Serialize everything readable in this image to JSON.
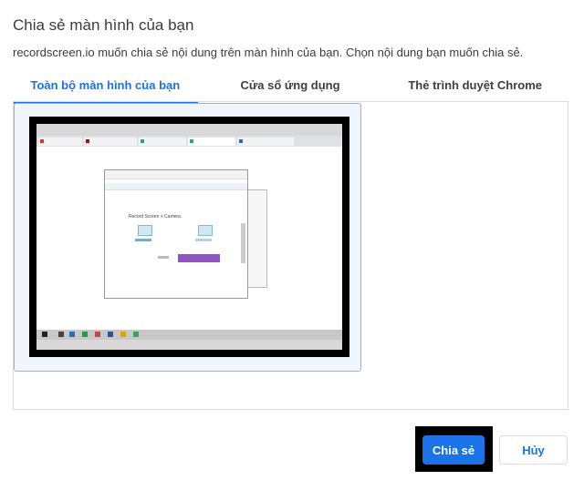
{
  "dialog": {
    "title": "Chia sẻ màn hình của bạn",
    "description": "recordscreen.io muốn chia sẻ nội dung trên màn hình của bạn. Chọn nội dung bạn muốn chia sẻ."
  },
  "tabs": [
    {
      "label": "Toàn bộ màn hình của bạn",
      "active": true
    },
    {
      "label": "Cửa sổ ứng dụng",
      "active": false
    },
    {
      "label": "Thẻ trình duyệt Chrome",
      "active": false
    }
  ],
  "preview": {
    "inner_heading": "Record Screen + Camera"
  },
  "buttons": {
    "share": "Chia sẻ",
    "cancel": "Hủy"
  },
  "colors": {
    "accent": "#1a73e8",
    "purple_button": "#8e54c6"
  }
}
